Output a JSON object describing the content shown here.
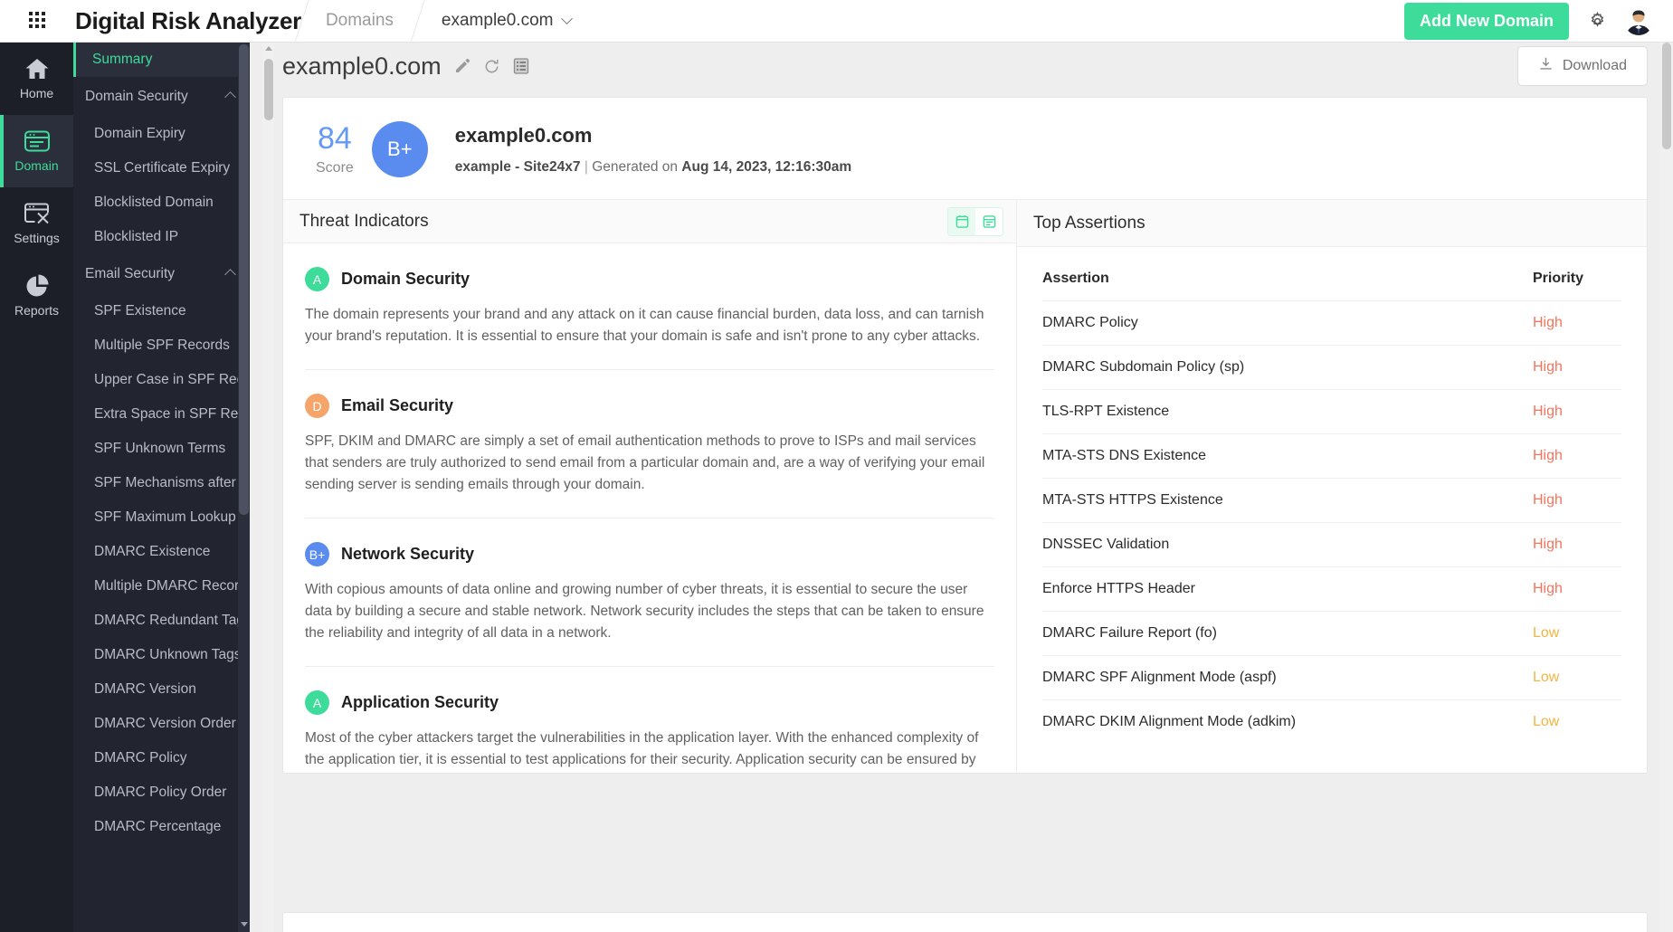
{
  "topbar": {
    "apps_icon": "grid-apps-icon",
    "app_title": "Digital Risk Analyzer",
    "breadcrumb_domains": "Domains",
    "breadcrumb_domain": "example0.com",
    "add_domain_label": "Add New Domain",
    "settings_icon": "gear-icon",
    "avatar_icon": "user-avatar"
  },
  "rail": {
    "items": [
      {
        "label": "Home",
        "icon": "home-icon",
        "active": false
      },
      {
        "label": "Domain",
        "icon": "domain-window-icon",
        "active": true
      },
      {
        "label": "Settings",
        "icon": "settings-tools-icon",
        "active": false
      },
      {
        "label": "Reports",
        "icon": "pie-chart-icon",
        "active": false
      }
    ]
  },
  "sidebar": {
    "summary": "Summary",
    "groups": [
      {
        "label": "Domain Security",
        "expanded": true,
        "items": [
          "Domain Expiry",
          "SSL Certificate Expiry",
          "Blocklisted Domain",
          "Blocklisted IP"
        ]
      },
      {
        "label": "Email Security",
        "expanded": true,
        "items": [
          "SPF Existence",
          "Multiple SPF Records",
          "Upper Case in SPF Recor...",
          "Extra Space in SPF Record",
          "SPF Unknown Terms",
          "SPF Mechanisms after \"all\"",
          "SPF Maximum Lookup",
          "DMARC Existence",
          "Multiple DMARC Records",
          "DMARC Redundant Tags",
          "DMARC Unknown Tags",
          "DMARC Version",
          "DMARC Version Order",
          "DMARC Policy",
          "DMARC Policy Order",
          "DMARC Percentage"
        ]
      }
    ]
  },
  "main": {
    "page_title": "example0.com",
    "edit_icon": "pencil-icon",
    "refresh_icon": "refresh-icon",
    "list_icon": "checklist-icon",
    "download_label": "Download",
    "download_icon": "download-icon"
  },
  "score": {
    "value": "84",
    "label": "Score",
    "grade": "B+",
    "grade_color": "#5a8cf0",
    "domain": "example0.com",
    "meta_account": "example - Site24x7",
    "meta_separator": "|",
    "meta_generated_prefix": "Generated on",
    "meta_generated_at": "Aug 14, 2023, 12:16:30am"
  },
  "threat_indicators": {
    "title": "Threat Indicators",
    "view_toggle": [
      {
        "icon": "card-view-icon",
        "active": true
      },
      {
        "icon": "list-view-icon",
        "active": false
      }
    ],
    "items": [
      {
        "grade": "A",
        "color": "#3ddc9a",
        "name": "Domain Security",
        "description": "The domain represents your brand and any attack on it can cause financial burden, data loss, and can tarnish your brand's reputation. It is essential to ensure that your domain is safe and isn't prone to any cyber attacks."
      },
      {
        "grade": "D",
        "color": "#f5a46a",
        "name": "Email Security",
        "description": "SPF, DKIM and DMARC are simply a set of email authentication methods to prove to ISPs and mail services that senders are truly authorized to send email from a particular domain and, are a way of verifying your email sending server is sending emails through your domain."
      },
      {
        "grade": "B+",
        "color": "#5a8cf0",
        "name": "Network Security",
        "description": "With copious amounts of data online and growing number of cyber threats, it is essential to secure the user data by building a secure and stable network. Network security includes the steps that can be taken to ensure the reliability and integrity of all data in a network."
      },
      {
        "grade": "A",
        "color": "#3ddc9a",
        "name": "Application Security",
        "description": "Most of the cyber attackers target the vulnerabilities in the application layer. With the enhanced complexity of the application tier, it is essential to test applications for their security. Application security can be ensured by constantly tracking the headers, by checking for any malware injections, defacement attacks, and much more."
      }
    ]
  },
  "top_assertions": {
    "title": "Top Assertions",
    "columns": [
      "Assertion",
      "Priority"
    ],
    "rows": [
      {
        "assertion": "DMARC Policy",
        "priority": "High"
      },
      {
        "assertion": "DMARC Subdomain Policy (sp)",
        "priority": "High"
      },
      {
        "assertion": "TLS-RPT Existence",
        "priority": "High"
      },
      {
        "assertion": "MTA-STS DNS Existence",
        "priority": "High"
      },
      {
        "assertion": "MTA-STS HTTPS Existence",
        "priority": "High"
      },
      {
        "assertion": "DNSSEC Validation",
        "priority": "High"
      },
      {
        "assertion": "Enforce HTTPS Header",
        "priority": "High"
      },
      {
        "assertion": "DMARC Failure Report (fo)",
        "priority": "Low"
      },
      {
        "assertion": "DMARC SPF Alignment Mode (aspf)",
        "priority": "Low"
      },
      {
        "assertion": "DMARC DKIM Alignment Mode (adkim)",
        "priority": "Low"
      }
    ]
  },
  "colors": {
    "accent_green": "#3ddc9a",
    "sidebar_bg": "#22242f",
    "rail_bg": "#1c1e28",
    "priority_high": "#f4745c",
    "priority_low": "#f2b53f",
    "blue": "#5a8cf0"
  }
}
